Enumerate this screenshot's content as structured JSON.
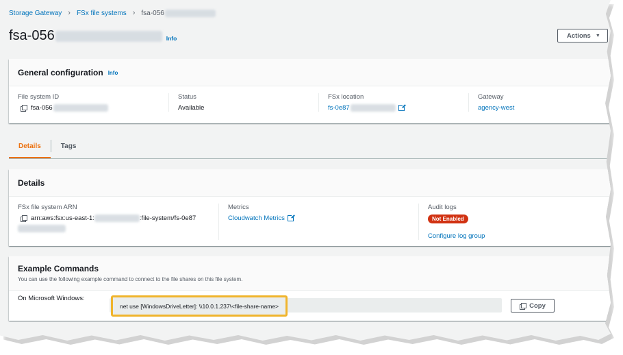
{
  "breadcrumb": {
    "items": [
      "Storage Gateway",
      "FSx file systems"
    ],
    "current": "fsa-056"
  },
  "header": {
    "title": "fsa-056",
    "info": "Info",
    "actions_label": "Actions"
  },
  "general": {
    "title": "General configuration",
    "info": "Info",
    "file_system_id": {
      "label": "File system ID",
      "value": "fsa-056"
    },
    "status": {
      "label": "Status",
      "value": "Available"
    },
    "fsx_location": {
      "label": "FSx location",
      "value": "fs-0e87"
    },
    "gateway": {
      "label": "Gateway",
      "value": "agency-west"
    }
  },
  "tabs": [
    {
      "label": "Details",
      "active": true
    },
    {
      "label": "Tags",
      "active": false
    }
  ],
  "details": {
    "title": "Details",
    "arn": {
      "label": "FSx file system ARN",
      "value_prefix": "arn:aws:fsx:us-east-1:",
      "value_suffix": ":file-system/fs-0e87"
    },
    "metrics": {
      "label": "Metrics",
      "link": "Cloudwatch Metrics"
    },
    "audit_logs": {
      "label": "Audit logs",
      "badge": "Not Enabled",
      "link": "Configure log group"
    }
  },
  "example": {
    "title": "Example Commands",
    "description": "You can use the following example command to connect to the file shares on this file system.",
    "windows_label": "On Microsoft Windows:",
    "command": "net use [WindowsDriveLetter]: \\\\10.0.1.237\\<file-share-name>",
    "copy_label": "Copy"
  },
  "colors": {
    "link": "#0073bb",
    "active_tab": "#ec7211",
    "badge_red": "#d13212",
    "highlight": "#f0b42c"
  },
  "icons": [
    "chevron-right-icon",
    "copy-icon",
    "external-link-icon",
    "caret-down-icon"
  ]
}
